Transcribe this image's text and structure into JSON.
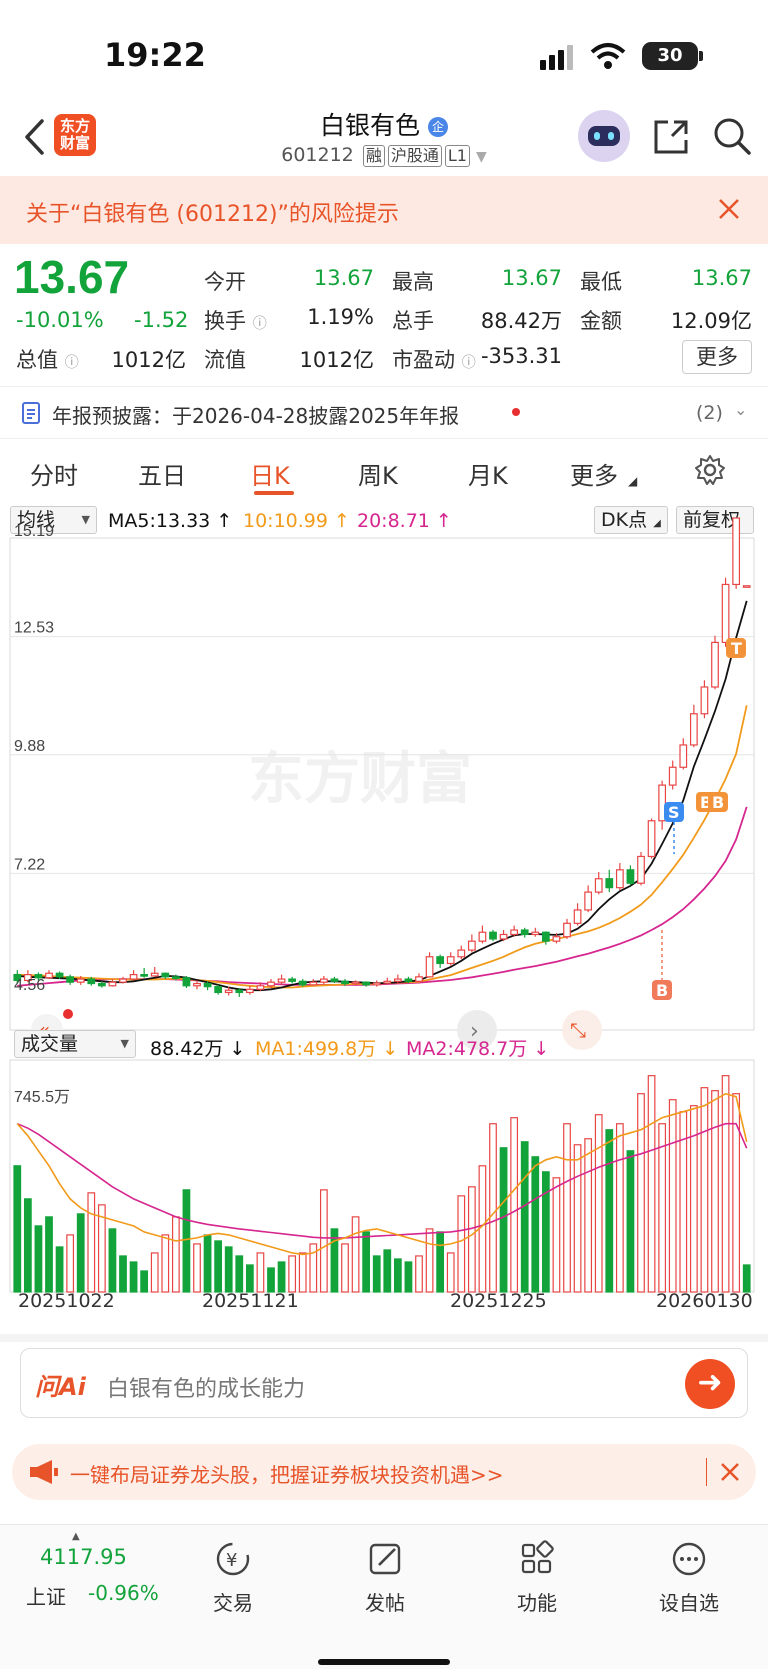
{
  "status": {
    "time": "19:22",
    "battery": "30"
  },
  "header": {
    "logo_text": "东方财富",
    "title": "白银有色",
    "title_badge": "企",
    "code": "601212",
    "tags": [
      "融",
      "沪股通",
      "L1"
    ]
  },
  "risk": {
    "text": "关于“白银有色 (601212)”的风险提示"
  },
  "quote": {
    "price": "13.67",
    "change_pct": "-10.01%",
    "change_amt": "-1.52",
    "fields": [
      {
        "label": "今开",
        "value": "13.67"
      },
      {
        "label": "最高",
        "value": "13.67"
      },
      {
        "label": "最低",
        "value": "13.67"
      },
      {
        "label": "换手",
        "value": "1.19%"
      },
      {
        "label": "总手",
        "value": "88.42万"
      },
      {
        "label": "金额",
        "value": "12.09亿"
      },
      {
        "label": "总值",
        "value": "1012亿"
      },
      {
        "label": "流值",
        "value": "1012亿"
      },
      {
        "label": "市盈动",
        "value": "-353.31"
      }
    ],
    "more_label": "更多"
  },
  "annual": {
    "text": "年报预披露：于2026-04-28披露2025年年报",
    "count": "(2)"
  },
  "tabs": [
    "分时",
    "五日",
    "日K",
    "周K",
    "月K",
    "更多"
  ],
  "kline": {
    "ma_selector": "均线",
    "ma5": "MA5:13.33",
    "ma10": "10:10.99",
    "ma20": "20:8.71",
    "dk_label": "DK点",
    "adjust_label": "前复权",
    "watermark": "东方财富",
    "markers": {
      "s": "S",
      "b": "B",
      "t": "T"
    }
  },
  "volume": {
    "selector": "成交量",
    "value": "88.42万",
    "ma1": "MA1:499.8万",
    "ma2": "MA2:478.7万",
    "max_label": "745.5万"
  },
  "dates": [
    "20251022",
    "20251121",
    "20251225",
    "20260130"
  ],
  "ai": {
    "logo": "问Ai",
    "placeholder": "白银有色的成长能力"
  },
  "promo": {
    "text": "一键布局证券龙头股，把握证券板块投资机遇>>"
  },
  "nav": {
    "index_value": "4117.95",
    "index_name": "上证",
    "index_change": "-0.96%",
    "items": [
      "交易",
      "发帖",
      "功能",
      "设自选"
    ]
  },
  "colors": {
    "up": "#e84545",
    "down": "#12a33a",
    "accent": "#e8542a",
    "ma5": "#111111",
    "ma10": "#f29a1a",
    "ma20": "#d6268f"
  },
  "chart_data": {
    "type": "candlestick",
    "y_ticks": [
      15.19,
      12.53,
      9.88,
      7.22,
      4.56
    ],
    "ylim": [
      4.56,
      15.19
    ],
    "candles": [
      [
        4.95,
        4.82,
        5.05,
        4.75
      ],
      [
        4.82,
        4.95,
        5.05,
        4.78
      ],
      [
        4.95,
        4.88,
        5.0,
        4.8
      ],
      [
        4.88,
        4.98,
        5.05,
        4.85
      ],
      [
        4.98,
        4.9,
        5.02,
        4.85
      ],
      [
        4.9,
        4.78,
        4.95,
        4.72
      ],
      [
        4.78,
        4.85,
        4.92,
        4.72
      ],
      [
        4.85,
        4.75,
        4.9,
        4.7
      ],
      [
        4.75,
        4.7,
        4.8,
        4.66
      ],
      [
        4.7,
        4.78,
        4.85,
        4.68
      ],
      [
        4.78,
        4.85,
        4.9,
        4.75
      ],
      [
        4.85,
        4.95,
        5.05,
        4.82
      ],
      [
        4.95,
        4.92,
        5.1,
        4.88
      ],
      [
        4.92,
        4.98,
        5.12,
        4.9
      ],
      [
        4.98,
        4.9,
        5.0,
        4.85
      ],
      [
        4.9,
        4.88,
        4.95,
        4.82
      ],
      [
        4.88,
        4.7,
        4.92,
        4.65
      ],
      [
        4.7,
        4.75,
        4.82,
        4.62
      ],
      [
        4.75,
        4.68,
        4.8,
        4.6
      ],
      [
        4.68,
        4.55,
        4.72,
        4.5
      ],
      [
        4.55,
        4.6,
        4.68,
        4.48
      ],
      [
        4.6,
        4.55,
        4.65,
        4.45
      ],
      [
        4.55,
        4.62,
        4.7,
        4.5
      ],
      [
        4.62,
        4.7,
        4.78,
        4.58
      ],
      [
        4.7,
        4.78,
        4.85,
        4.65
      ],
      [
        4.78,
        4.85,
        4.95,
        4.72
      ],
      [
        4.85,
        4.8,
        4.9,
        4.75
      ],
      [
        4.8,
        4.72,
        4.85,
        4.68
      ],
      [
        4.72,
        4.78,
        4.85,
        4.7
      ],
      [
        4.78,
        4.85,
        4.92,
        4.74
      ],
      [
        4.85,
        4.8,
        4.9,
        4.76
      ],
      [
        4.8,
        4.75,
        4.85,
        4.7
      ],
      [
        4.75,
        4.78,
        4.82,
        4.7
      ],
      [
        4.78,
        4.72,
        4.8,
        4.68
      ],
      [
        4.72,
        4.76,
        4.82,
        4.68
      ],
      [
        4.76,
        4.8,
        4.88,
        4.72
      ],
      [
        4.8,
        4.85,
        4.95,
        4.75
      ],
      [
        4.85,
        4.8,
        4.9,
        4.76
      ],
      [
        4.8,
        4.9,
        4.98,
        4.78
      ],
      [
        4.9,
        5.35,
        5.45,
        4.88
      ],
      [
        5.35,
        5.2,
        5.4,
        5.1
      ],
      [
        5.2,
        5.35,
        5.45,
        5.15
      ],
      [
        5.35,
        5.5,
        5.6,
        5.3
      ],
      [
        5.5,
        5.7,
        5.85,
        5.45
      ],
      [
        5.7,
        5.9,
        6.05,
        5.65
      ],
      [
        5.9,
        5.75,
        5.95,
        5.7
      ],
      [
        5.75,
        5.85,
        5.95,
        5.7
      ],
      [
        5.85,
        5.95,
        6.05,
        5.8
      ],
      [
        5.95,
        5.85,
        6.0,
        5.78
      ],
      [
        5.85,
        5.9,
        6.0,
        5.8
      ],
      [
        5.9,
        5.7,
        5.92,
        5.62
      ],
      [
        5.7,
        5.8,
        5.88,
        5.65
      ],
      [
        5.8,
        6.1,
        6.2,
        5.75
      ],
      [
        6.1,
        6.4,
        6.55,
        6.05
      ],
      [
        6.4,
        6.8,
        6.95,
        6.35
      ],
      [
        6.8,
        7.1,
        7.25,
        6.75
      ],
      [
        7.1,
        6.9,
        7.3,
        6.8
      ],
      [
        6.9,
        7.3,
        7.45,
        6.85
      ],
      [
        7.3,
        7.0,
        7.4,
        6.95
      ],
      [
        7.0,
        7.6,
        7.7,
        6.95
      ],
      [
        7.6,
        8.4,
        8.45,
        7.55
      ],
      [
        8.4,
        9.2,
        9.3,
        8.2
      ],
      [
        9.2,
        9.6,
        9.75,
        9.1
      ],
      [
        9.6,
        10.1,
        10.25,
        9.55
      ],
      [
        10.1,
        10.8,
        11.0,
        10.05
      ],
      [
        10.8,
        11.4,
        11.55,
        10.7
      ],
      [
        11.4,
        12.4,
        12.55,
        11.35
      ],
      [
        12.4,
        13.7,
        13.85,
        12.3
      ],
      [
        13.7,
        15.19,
        15.19,
        13.6
      ],
      [
        13.67,
        13.67,
        13.67,
        13.67
      ]
    ],
    "ma5": [
      4.92,
      4.9,
      4.89,
      4.88,
      4.87,
      4.86,
      4.84,
      4.82,
      4.8,
      4.78,
      4.78,
      4.8,
      4.84,
      4.88,
      4.92,
      4.91,
      4.88,
      4.83,
      4.78,
      4.72,
      4.66,
      4.62,
      4.6,
      4.6,
      4.62,
      4.66,
      4.72,
      4.77,
      4.79,
      4.8,
      4.8,
      4.79,
      4.78,
      4.77,
      4.76,
      4.76,
      4.78,
      4.8,
      4.82,
      4.92,
      5.02,
      5.12,
      5.26,
      5.42,
      5.53,
      5.64,
      5.74,
      5.83,
      5.86,
      5.86,
      5.85,
      5.84,
      5.87,
      5.98,
      6.16,
      6.42,
      6.64,
      6.82,
      6.94,
      7.1,
      7.44,
      7.88,
      8.34,
      8.86,
      9.62,
      10.22,
      10.86,
      11.58,
      12.5,
      13.33
    ],
    "ma10": [
      4.95,
      4.94,
      4.93,
      4.92,
      4.9,
      4.89,
      4.88,
      4.87,
      4.86,
      4.85,
      4.84,
      4.84,
      4.84,
      4.84,
      4.85,
      4.86,
      4.85,
      4.83,
      4.81,
      4.78,
      4.75,
      4.72,
      4.7,
      4.68,
      4.67,
      4.66,
      4.66,
      4.68,
      4.7,
      4.71,
      4.72,
      4.73,
      4.74,
      4.74,
      4.75,
      4.76,
      4.77,
      4.78,
      4.79,
      4.84,
      4.89,
      4.94,
      5.02,
      5.1,
      5.18,
      5.26,
      5.35,
      5.46,
      5.56,
      5.64,
      5.7,
      5.75,
      5.8,
      5.86,
      5.92,
      6.0,
      6.1,
      6.22,
      6.36,
      6.52,
      6.74,
      7.02,
      7.32,
      7.64,
      8.02,
      8.42,
      8.86,
      9.34,
      9.9,
      10.99
    ],
    "ma20": [
      4.7,
      4.72,
      4.74,
      4.76,
      4.78,
      4.8,
      4.82,
      4.83,
      4.84,
      4.85,
      4.85,
      4.85,
      4.85,
      4.85,
      4.85,
      4.84,
      4.83,
      4.82,
      4.81,
      4.8,
      4.78,
      4.77,
      4.76,
      4.75,
      4.74,
      4.73,
      4.72,
      4.72,
      4.72,
      4.72,
      4.72,
      4.72,
      4.72,
      4.72,
      4.73,
      4.74,
      4.75,
      4.76,
      4.77,
      4.79,
      4.81,
      4.83,
      4.86,
      4.89,
      4.93,
      4.97,
      5.01,
      5.06,
      5.1,
      5.14,
      5.19,
      5.24,
      5.3,
      5.36,
      5.42,
      5.49,
      5.56,
      5.64,
      5.73,
      5.83,
      5.95,
      6.08,
      6.24,
      6.42,
      6.64,
      6.88,
      7.16,
      7.5,
      7.98,
      8.71
    ],
    "volume": [
      420,
      310,
      220,
      250,
      150,
      190,
      260,
      330,
      290,
      210,
      120,
      100,
      70,
      130,
      190,
      250,
      340,
      160,
      190,
      170,
      150,
      120,
      90,
      130,
      80,
      100,
      120,
      130,
      160,
      340,
      210,
      160,
      250,
      200,
      120,
      140,
      110,
      100,
      120,
      210,
      200,
      130,
      320,
      350,
      420,
      560,
      480,
      580,
      500,
      450,
      400,
      380,
      560,
      490,
      510,
      590,
      540,
      560,
      470,
      660,
      720,
      560,
      640,
      600,
      620,
      680,
      670,
      720,
      660,
      90
    ],
    "volume_up": [
      false,
      false,
      false,
      false,
      false,
      true,
      false,
      true,
      true,
      false,
      false,
      false,
      false,
      true,
      true,
      true,
      false,
      true,
      false,
      false,
      false,
      false,
      false,
      true,
      false,
      false,
      true,
      true,
      true,
      true,
      false,
      true,
      true,
      false,
      false,
      false,
      false,
      false,
      true,
      true,
      false,
      true,
      true,
      true,
      true,
      true,
      false,
      true,
      false,
      false,
      false,
      true,
      true,
      true,
      true,
      true,
      false,
      true,
      false,
      true,
      true,
      true,
      true,
      true,
      true,
      true,
      true,
      true,
      true,
      false
    ],
    "vol_ma1": [
      560,
      520,
      470,
      420,
      360,
      310,
      280,
      260,
      250,
      240,
      230,
      220,
      200,
      190,
      180,
      170,
      175,
      180,
      190,
      195,
      190,
      180,
      170,
      160,
      150,
      140,
      130,
      125,
      130,
      150,
      170,
      180,
      195,
      205,
      210,
      200,
      190,
      180,
      170,
      160,
      155,
      160,
      170,
      190,
      220,
      260,
      300,
      340,
      380,
      420,
      440,
      450,
      440,
      440,
      460,
      480,
      500,
      520,
      530,
      540,
      560,
      580,
      590,
      600,
      610,
      620,
      640,
      660,
      650,
      499.8
    ],
    "vol_ma2": [
      560,
      545,
      525,
      500,
      475,
      450,
      425,
      400,
      375,
      350,
      330,
      310,
      295,
      280,
      265,
      250,
      240,
      232,
      225,
      220,
      215,
      210,
      206,
      202,
      198,
      194,
      190,
      186,
      182,
      180,
      180,
      180,
      182,
      184,
      186,
      188,
      190,
      192,
      194,
      196,
      198,
      200,
      205,
      212,
      222,
      235,
      250,
      268,
      288,
      310,
      330,
      350,
      368,
      385,
      400,
      415,
      428,
      440,
      450,
      460,
      472,
      484,
      496,
      508,
      520,
      534,
      548,
      560,
      560,
      478.7
    ],
    "vol_ylim": [
      0,
      745.5
    ]
  }
}
